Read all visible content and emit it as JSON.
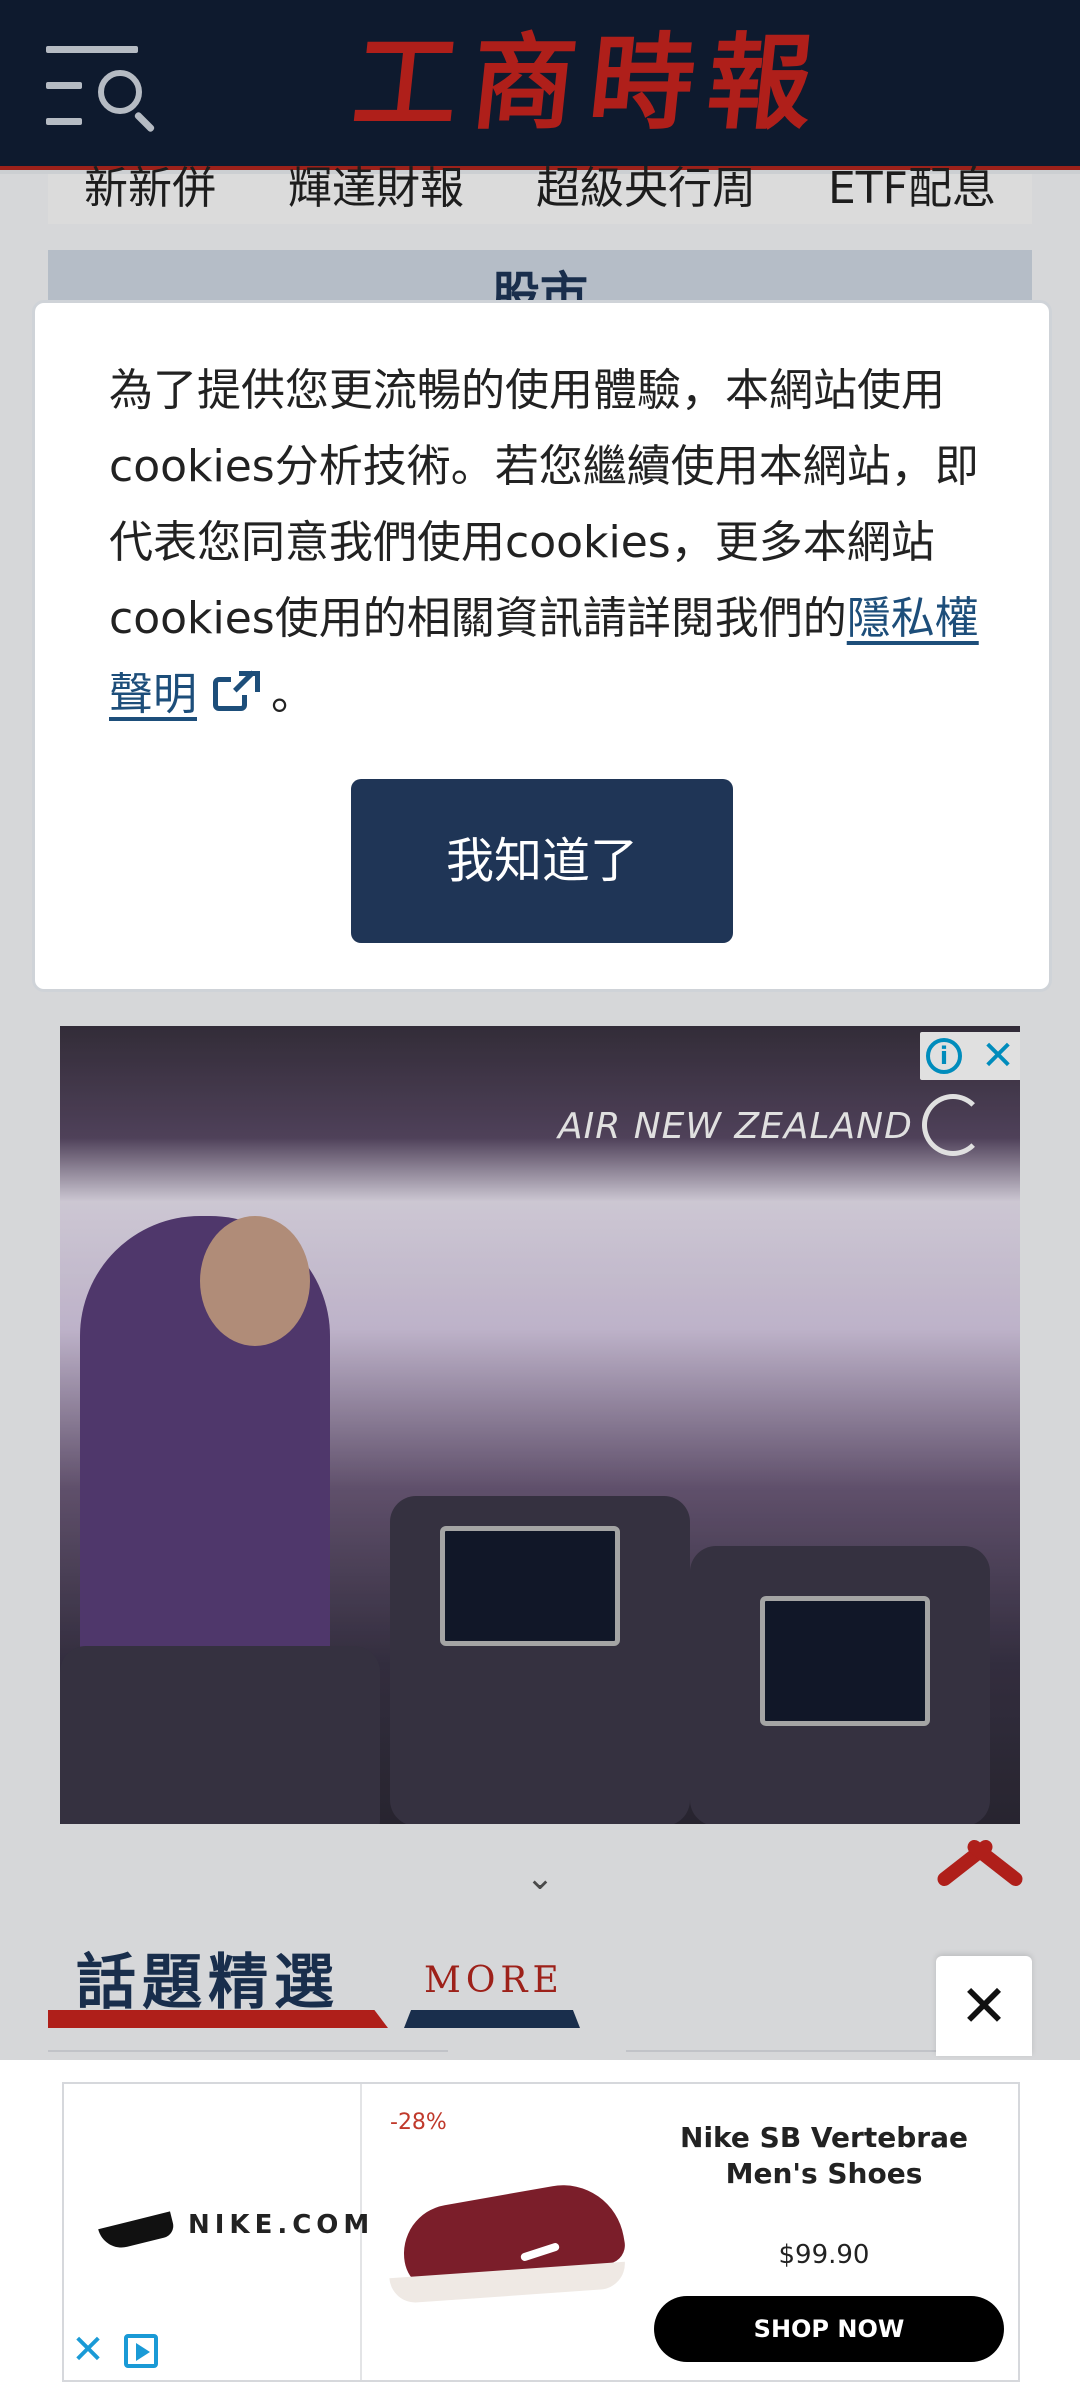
{
  "header": {
    "logo_text": "工商時報",
    "menu_icon": "menu-search-icon"
  },
  "topics": [
    "新新併",
    "輝達財報",
    "超級央行周",
    "ETF配息"
  ],
  "section_title": "股市",
  "cookie_dialog": {
    "message": "為了提供您更流暢的使用體驗，本網站使用cookies分析技術。若您繼續使用本網站，即代表您同意我們使用cookies，更多本網站cookies使用的相關資訊請詳閱我們的",
    "privacy_link": "隱私權聲明",
    "trailing": "。",
    "link_icon": "external-link-icon",
    "button_label": "我知道了"
  },
  "ad_banner": {
    "brand_text": "AIR NEW ZEALAND",
    "info_icon": "info-icon",
    "close_icon": "close-icon"
  },
  "topic_section": {
    "heading": "話題精選",
    "more_label": "MORE"
  },
  "sticky_close_label": "✕",
  "bottom_ad": {
    "brand_name": "NIKE.COM",
    "discount": "-28%",
    "product_name": "Nike SB Vertebrae Men's Shoes",
    "price": "$99.90",
    "cta_label": "SHOP NOW",
    "adchoice_close": "✕"
  },
  "colors": {
    "header_bg": "#111e35",
    "brand_red": "#c8241e",
    "navy": "#1f3556",
    "link": "#1d4e7a"
  }
}
